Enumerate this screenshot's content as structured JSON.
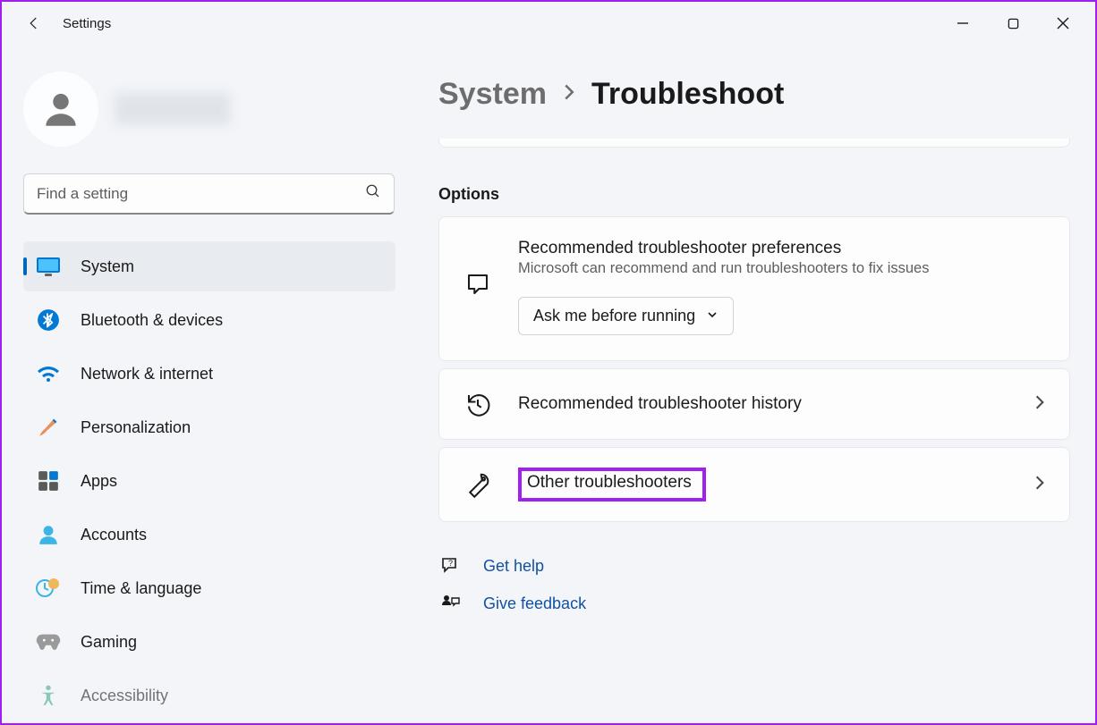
{
  "window": {
    "title": "Settings"
  },
  "search": {
    "placeholder": "Find a setting"
  },
  "nav": [
    {
      "label": "System"
    },
    {
      "label": "Bluetooth & devices"
    },
    {
      "label": "Network & internet"
    },
    {
      "label": "Personalization"
    },
    {
      "label": "Apps"
    },
    {
      "label": "Accounts"
    },
    {
      "label": "Time & language"
    },
    {
      "label": "Gaming"
    },
    {
      "label": "Accessibility"
    }
  ],
  "breadcrumb": {
    "parent": "System",
    "current": "Troubleshoot"
  },
  "section_label": "Options",
  "cards": {
    "preferences": {
      "title": "Recommended troubleshooter preferences",
      "subtitle": "Microsoft can recommend and run troubleshooters to fix issues",
      "dropdown_value": "Ask me before running"
    },
    "history": {
      "title": "Recommended troubleshooter history"
    },
    "other": {
      "title": "Other troubleshooters"
    }
  },
  "footer": {
    "help": "Get help",
    "feedback": "Give feedback"
  }
}
